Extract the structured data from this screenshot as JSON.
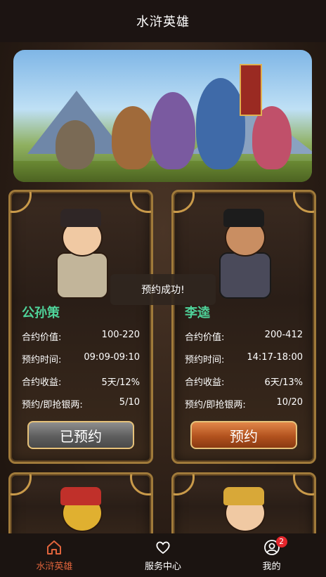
{
  "header": {
    "title": "水浒英雄"
  },
  "cards": [
    {
      "name": "公孙策",
      "rows": [
        {
          "label": "合约价值:",
          "value": "100-220"
        },
        {
          "label": "预约时间:",
          "value": "09:09-09:10"
        },
        {
          "label": "合约收益:",
          "value": "5天/12%"
        },
        {
          "label": "预约/即抢银两:",
          "value": "5/10"
        }
      ],
      "button": "已预约"
    },
    {
      "name": "李逵",
      "rows": [
        {
          "label": "合约价值:",
          "value": "200-412"
        },
        {
          "label": "预约时间:",
          "value": "14:17-18:00"
        },
        {
          "label": "合约收益:",
          "value": "6天/13%"
        },
        {
          "label": "预约/即抢银两:",
          "value": "10/20"
        }
      ],
      "button": "预约"
    }
  ],
  "toast": {
    "text": "预约成功!"
  },
  "tabbar": {
    "items": [
      {
        "label": "水浒英雄",
        "icon": "home-icon"
      },
      {
        "label": "服务中心",
        "icon": "heart-icon"
      },
      {
        "label": "我的",
        "icon": "user-icon",
        "badge": "2"
      }
    ]
  },
  "colors": {
    "accent": "#e0643c",
    "name_green": "#4fd39a",
    "badge_red": "#e4262c"
  }
}
